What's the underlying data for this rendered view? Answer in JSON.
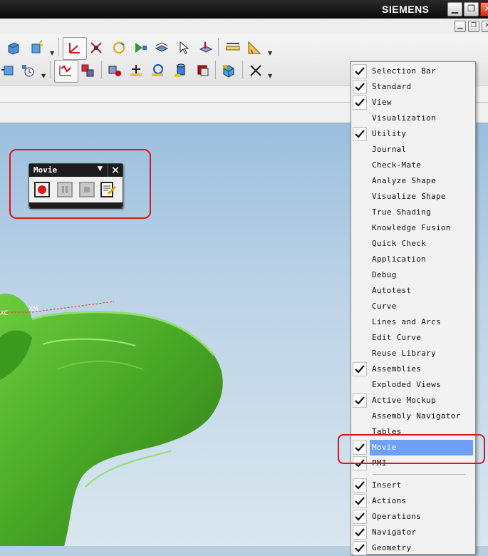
{
  "app": {
    "brand": "SIEMENS"
  },
  "window_buttons": {
    "minimize": "▁",
    "restore": "❐",
    "close": "✕"
  },
  "movie_toolbar": {
    "title": "Movie",
    "buttons": [
      "record-icon",
      "pause-icon",
      "stop-icon",
      "settings-icon"
    ]
  },
  "viewport": {
    "axis_label_xc": "XC",
    "axis_label_xm": "XM",
    "model_color": "#4aa626"
  },
  "menu": {
    "items": [
      {
        "label": "Selection Bar",
        "checked": true
      },
      {
        "label": "Standard",
        "checked": true
      },
      {
        "label": "View",
        "checked": true
      },
      {
        "label": "Visualization",
        "checked": false
      },
      {
        "label": "Utility",
        "checked": true
      },
      {
        "label": "Journal",
        "checked": false
      },
      {
        "label": "Check-Mate",
        "checked": false
      },
      {
        "label": "Analyze Shape",
        "checked": false
      },
      {
        "label": "Visualize Shape",
        "checked": false
      },
      {
        "label": "True Shading",
        "checked": false
      },
      {
        "label": "Knowledge Fusion",
        "checked": false
      },
      {
        "label": "Quick Check",
        "checked": false
      },
      {
        "label": "Application",
        "checked": false
      },
      {
        "label": "Debug",
        "checked": false
      },
      {
        "label": "Autotest",
        "checked": false
      },
      {
        "label": "Curve",
        "checked": false
      },
      {
        "label": "Lines and Arcs",
        "checked": false
      },
      {
        "label": "Edit Curve",
        "checked": false
      },
      {
        "label": "Reuse Library",
        "checked": false
      },
      {
        "label": "Assemblies",
        "checked": true
      },
      {
        "label": "Exploded Views",
        "checked": false
      },
      {
        "label": "Active Mockup",
        "checked": true
      },
      {
        "label": "Assembly Navigator",
        "checked": false
      },
      {
        "label": "Tables",
        "checked": false
      },
      {
        "label": "Movie",
        "checked": true,
        "highlighted": true
      },
      {
        "label": "PMI",
        "checked": true
      },
      {
        "label": "Insert",
        "checked": true
      },
      {
        "label": "Actions",
        "checked": true
      },
      {
        "label": "Operations",
        "checked": true
      },
      {
        "label": "Navigator",
        "checked": true
      },
      {
        "label": "Geometry",
        "checked": true
      }
    ]
  },
  "colors": {
    "highlight": "#6fa0f7",
    "annotation": "#e0131b",
    "titlebar": "#111111"
  }
}
